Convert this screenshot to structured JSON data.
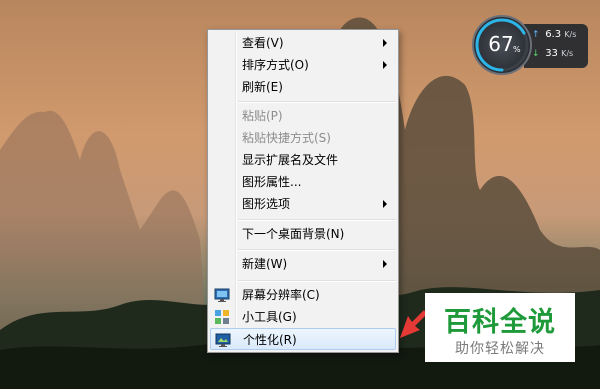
{
  "menu": {
    "items": [
      {
        "label": "查看(V)",
        "submenu": true,
        "disabled": false
      },
      {
        "label": "排序方式(O)",
        "submenu": true,
        "disabled": false
      },
      {
        "label": "刷新(E)",
        "submenu": false,
        "disabled": false
      },
      {
        "label": "粘贴(P)",
        "submenu": false,
        "disabled": true
      },
      {
        "label": "粘贴快捷方式(S)",
        "submenu": false,
        "disabled": true
      },
      {
        "label": "显示扩展名及文件",
        "submenu": false,
        "disabled": false
      },
      {
        "label": "图形属性...",
        "submenu": false,
        "disabled": false
      },
      {
        "label": "图形选项",
        "submenu": true,
        "disabled": false
      },
      {
        "label": "下一个桌面背景(N)",
        "submenu": false,
        "disabled": false
      },
      {
        "label": "新建(W)",
        "submenu": true,
        "disabled": false
      },
      {
        "label": "屏幕分辨率(C)",
        "submenu": false,
        "disabled": false,
        "icon": "monitor-icon"
      },
      {
        "label": "小工具(G)",
        "submenu": false,
        "disabled": false,
        "icon": "gadgets-icon"
      },
      {
        "label": "个性化(R)",
        "submenu": false,
        "disabled": false,
        "icon": "personalize-icon",
        "highlighted": true
      }
    ]
  },
  "gadget": {
    "percent": "67",
    "percent_sign": "%",
    "upload": "6.3",
    "upload_unit": "K/s",
    "download": "33",
    "download_unit": "K/s",
    "level": 0.67
  },
  "watermark": {
    "title": "百科全说",
    "subtitle": "助你轻松解决"
  },
  "colors": {
    "accent_green": "#1f9a3a",
    "pointer_red": "#e53935",
    "highlight_border": "#aeccee"
  }
}
